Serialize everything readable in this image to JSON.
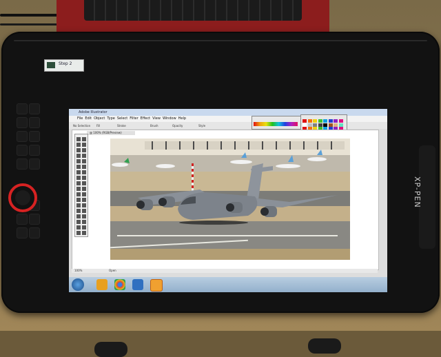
{
  "tablet": {
    "brand": "XP-PEN",
    "step_badge": "Step 2"
  },
  "app": {
    "title": "Adobe Illustrator",
    "menu": [
      "File",
      "Edit",
      "Object",
      "Type",
      "Select",
      "Filter",
      "Effect",
      "View",
      "Window",
      "Help"
    ],
    "control_bar": {
      "selection": "No Selection",
      "fill": "Fill",
      "stroke": "Stroke",
      "brush": "Brush",
      "opacity": "Opacity",
      "style": "Style"
    },
    "document_tab": "@ 100% (RGB/Preview)",
    "status_zoom": "100%",
    "status_tool": "Open"
  },
  "colors": {
    "dial_ring": "#d62222",
    "taskbar": "#a8c0d8",
    "keyboard_case": "#8c1d1d"
  },
  "icons": [
    "windows-start-icon",
    "media-player-icon",
    "chrome-icon",
    "explorer-icon",
    "illustrator-icon"
  ]
}
